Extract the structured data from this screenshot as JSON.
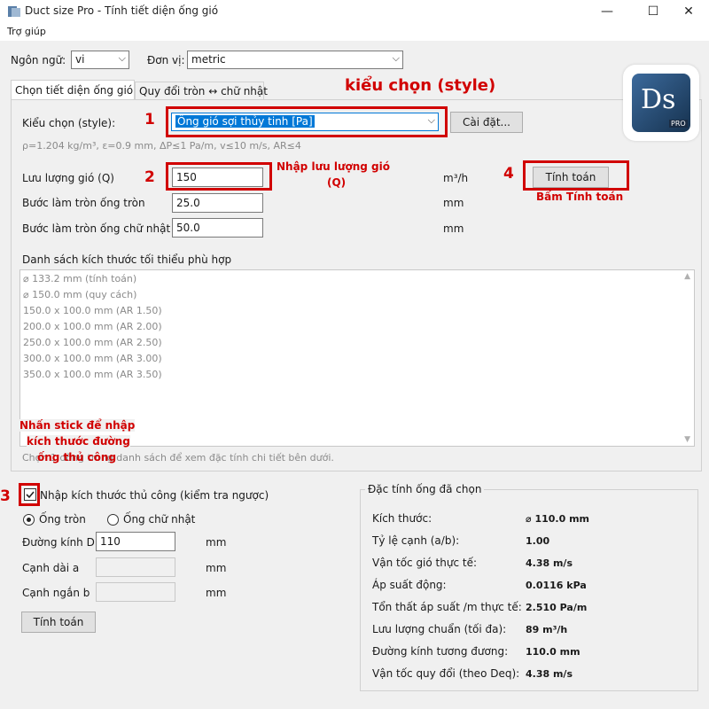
{
  "window": {
    "title": "Duct size Pro - Tính tiết diện ống gió",
    "minimize": "—",
    "maximize": "☐",
    "close": "✕"
  },
  "menu": {
    "help": "Trợ giúp"
  },
  "top": {
    "language_label": "Ngôn ngữ:",
    "language_value": "vi",
    "unit_label": "Đơn vị:",
    "unit_value": "metric"
  },
  "tabs": [
    {
      "label": "Chọn tiết diện ống gió",
      "active": true
    },
    {
      "label": "Quy đổi tròn ↔ chữ nhật",
      "active": false
    }
  ],
  "style": {
    "label": "Kiểu chọn (style):",
    "value": "Ống gió sợi thủy tinh [Pa]",
    "settings_button": "Cài đặt...",
    "params": "ρ=1.204 kg/m³, ε=0.9 mm, ΔP≤1 Pa/m, v≤10 m/s, AR≤4"
  },
  "inputs": {
    "flow_label": "Lưu lượng gió (Q)",
    "flow_value": "150",
    "flow_unit": "m³/h",
    "round_step_label": "Bước làm tròn ống tròn",
    "round_step_value": "25.0",
    "round_step_unit": "mm",
    "rect_step_label": "Bước làm tròn ống chữ nhật",
    "rect_step_value": "50.0",
    "rect_step_unit": "mm",
    "calculate_button": "Tính toán"
  },
  "results": {
    "list_title": "Danh sách kích thước tối thiểu phù hợp",
    "items": [
      "⌀ 133.2 mm   (tính toán)",
      "⌀ 150.0 mm   (quy cách)",
      "150.0 x 100.0 mm   (AR 1.50)",
      "200.0 x 100.0 mm   (AR 2.00)",
      "250.0 x 100.0 mm   (AR 2.50)",
      "300.0 x 100.0 mm   (AR 3.00)",
      "350.0 x 100.0 mm   (AR 3.50)"
    ],
    "hint": "Chọn 1 dòng trong danh sách để xem đặc tính chi tiết bên dưới."
  },
  "manual": {
    "checkbox_label": "Nhập kích thước thủ công (kiểm tra ngược)",
    "checked": true,
    "radio_round": "Ống tròn",
    "radio_rect": "Ống chữ nhật",
    "diameter_label": "Đường kính D",
    "diameter_value": "110",
    "diameter_unit": "mm",
    "side_a_label": "Cạnh dài a",
    "side_a_unit": "mm",
    "side_b_label": "Cạnh ngắn b",
    "side_b_unit": "mm",
    "calculate_button": "Tính toán"
  },
  "properties": {
    "title": "Đặc tính ống đã chọn",
    "rows": [
      {
        "label": "Kích thước:",
        "value": "⌀ 110.0 mm"
      },
      {
        "label": "Tỷ lệ cạnh (a/b):",
        "value": "1.00"
      },
      {
        "label": "Vận tốc gió thực tế:",
        "value": "4.38 m/s"
      },
      {
        "label": "Áp suất động:",
        "value": "0.0116 kPa"
      },
      {
        "label": "Tổn thất áp suất /m thực tế:",
        "value": "2.510 Pa/m"
      },
      {
        "label": "Lưu lượng chuẩn (tối đa):",
        "value": "89 m³/h"
      },
      {
        "label": "Đường kính tương đương:",
        "value": "110.0 mm"
      },
      {
        "label": "Vận tốc quy đổi (theo Deq):",
        "value": "4.38 m/s"
      }
    ]
  },
  "annotations": {
    "style_heading": "kiểu chọn (style)",
    "n1": "1",
    "n2": "2",
    "n3": "3",
    "n4": "4",
    "flow_note_line1": "Nhập lưu lượng gió",
    "flow_note_line2": "(Q)",
    "calc_note": "Bấm Tính toán",
    "manual_note_line1": "Nhấn stick để nhập",
    "manual_note_line2": "kích thước đường",
    "manual_note_line3": "ống thủ công"
  },
  "logo": {
    "text": "Ds",
    "badge": "PRO"
  },
  "colors": {
    "accent": "#d10000",
    "selection": "#0078d7"
  }
}
